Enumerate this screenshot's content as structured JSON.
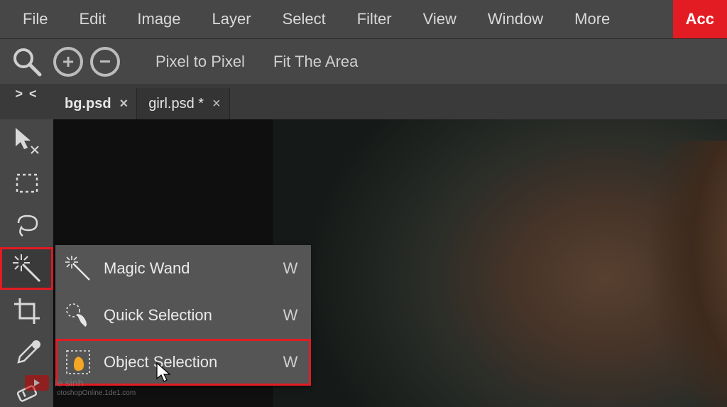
{
  "menu": {
    "items": [
      "File",
      "Edit",
      "Image",
      "Layer",
      "Select",
      "Filter",
      "View",
      "Window",
      "More"
    ],
    "account": "Acc"
  },
  "options": {
    "pixel_label": "Pixel to Pixel",
    "fit_label": "Fit The Area"
  },
  "bowtie": "> <",
  "tabs": [
    {
      "label": "bg.psd",
      "close": "×",
      "active": true
    },
    {
      "label": "girl.psd *",
      "close": "×",
      "active": false
    }
  ],
  "tools": [
    {
      "id": "move"
    },
    {
      "id": "rect-select"
    },
    {
      "id": "lasso"
    },
    {
      "id": "wand",
      "active": true
    },
    {
      "id": "crop"
    },
    {
      "id": "eyedropper"
    },
    {
      "id": "healing"
    }
  ],
  "flyout": [
    {
      "icon": "wand",
      "label": "Magic Wand",
      "key": "W",
      "hi": false
    },
    {
      "icon": "quick-select",
      "label": "Quick Selection",
      "key": "W",
      "hi": false
    },
    {
      "icon": "object-select",
      "label": "Object Selection",
      "key": "W",
      "hi": true
    }
  ],
  "watermark": {
    "brand": "le sinh",
    "line2": "otoshopOnline.1de1.com"
  }
}
